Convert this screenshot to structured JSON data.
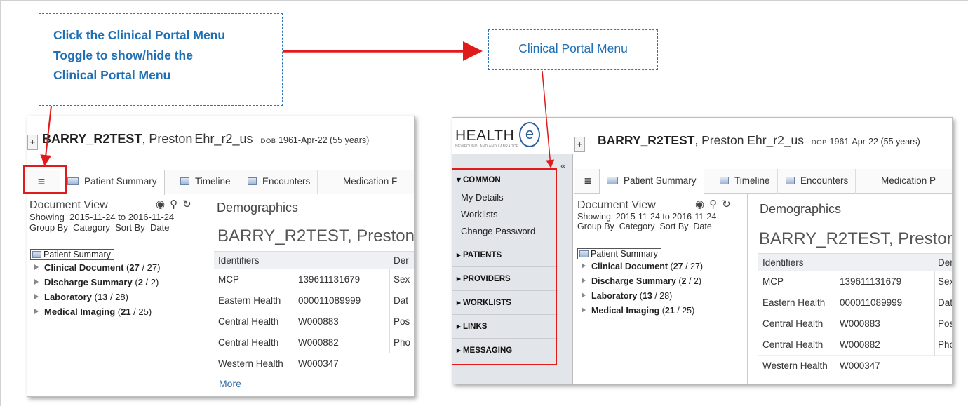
{
  "callouts": {
    "toggle_note": [
      "Click the Clinical Portal Menu",
      "Toggle to show/hide the",
      "Clinical Portal Menu"
    ],
    "menu_note": "Clinical Portal Menu"
  },
  "patient": {
    "last_name": "BARRY_R2TEST",
    "first_names": ", Preston",
    "first_names_full": ", Preston Ehr_r2_us",
    "dob_label": "DOB",
    "dob_value": "1961-Apr-22 (55 years)"
  },
  "tabs": {
    "menu_toggle_icon": "hamburger-icon",
    "patient_summary": "Patient Summary",
    "timeline": "Timeline",
    "encounters": "Encounters",
    "medication_cut": "Medication F",
    "medication_cut2": "Medication P"
  },
  "document_view": {
    "heading": "Document View",
    "showing_label": "Showing",
    "date_range": "2015-11-24 to 2016-11-24",
    "group_by_label": "Group By",
    "group_by_value": "Category",
    "sort_by_label": "Sort By",
    "sort_by_value": "Date",
    "icons": [
      "eye-icon",
      "search-icon",
      "refresh-icon"
    ]
  },
  "tree": {
    "root": "Patient Summary",
    "items": [
      {
        "label": "Clinical Document",
        "count": "27",
        "total": " / 27)"
      },
      {
        "label": "Discharge Summary",
        "count": "2",
        "total": " / 2)"
      },
      {
        "label": "Laboratory",
        "count": "13",
        "total": " / 28)"
      },
      {
        "label": "Medical Imaging",
        "count": "21",
        "total": " / 25)"
      }
    ]
  },
  "demographics": {
    "heading": "Demographics",
    "name": "BARRY_R2TEST, Preston",
    "identifiers_header": "Identifiers",
    "second_header_cut": "Der",
    "rows": [
      {
        "label": "MCP",
        "value": "139611131679",
        "side1": "Sex",
        "side2": "Sex"
      },
      {
        "label": "Eastern Health",
        "value": "000011089999",
        "side1": "Dat",
        "side2": "Dat"
      },
      {
        "label": "Central Health",
        "value": "W000883",
        "side1": "Pos",
        "side2": "Pos"
      },
      {
        "label": "Central Health",
        "value": "W000882",
        "side1": "Pho",
        "side2": "Pho"
      },
      {
        "label": "Western Health",
        "value": "W000347",
        "side1": "",
        "side2": ""
      }
    ],
    "more": "More"
  },
  "side_menu": {
    "logo_text": "HEALTH",
    "logo_e": "e",
    "logo_tagline": "NEWFOUNDLAND AND LABRADOR",
    "collapse_glyph": "«",
    "sections": [
      {
        "label": "▾ COMMON",
        "items": [
          "My Details",
          "Worklists",
          "Change Password"
        ]
      },
      {
        "label": "▸ PATIENTS"
      },
      {
        "label": "▸ PROVIDERS"
      },
      {
        "label": "▸ WORKLISTS"
      },
      {
        "label": "▸ LINKS"
      },
      {
        "label": "▸ MESSAGING"
      }
    ]
  },
  "colors": {
    "annotation_red": "#e01b1b",
    "callout_blue": "#1f6fb5"
  }
}
